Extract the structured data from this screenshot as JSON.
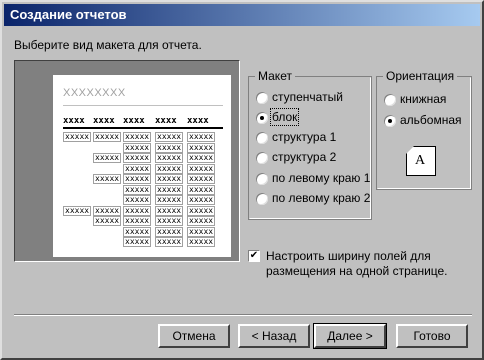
{
  "window": {
    "title": "Создание отчетов"
  },
  "instruction": "Выберите вид макета для отчета.",
  "preview": {
    "title": "XXXXXXXX",
    "headers": [
      "xxxx",
      "xxxx",
      "xxxx",
      "xxxx",
      "xxxx"
    ],
    "cell": "xxxxx"
  },
  "layout_group": {
    "legend": "Макет",
    "options": [
      {
        "label": "ступенчатый",
        "selected": false
      },
      {
        "label": "блок",
        "selected": true
      },
      {
        "label": "структура 1",
        "selected": false
      },
      {
        "label": "структура 2",
        "selected": false
      },
      {
        "label": "по левому краю 1",
        "selected": false
      },
      {
        "label": "по левому краю 2",
        "selected": false
      }
    ]
  },
  "orientation_group": {
    "legend": "Ориентация",
    "options": [
      {
        "label": "книжная",
        "selected": false
      },
      {
        "label": "альбомная",
        "selected": true
      }
    ],
    "icon_letter": "A"
  },
  "fit_checkbox": {
    "checked": true,
    "label_line1": "Настроить ширину полей для",
    "label_line2": "размещения на одной странице."
  },
  "buttons": {
    "cancel": "Отмена",
    "back": "< Назад",
    "next": "Далее >",
    "finish": "Готово"
  }
}
